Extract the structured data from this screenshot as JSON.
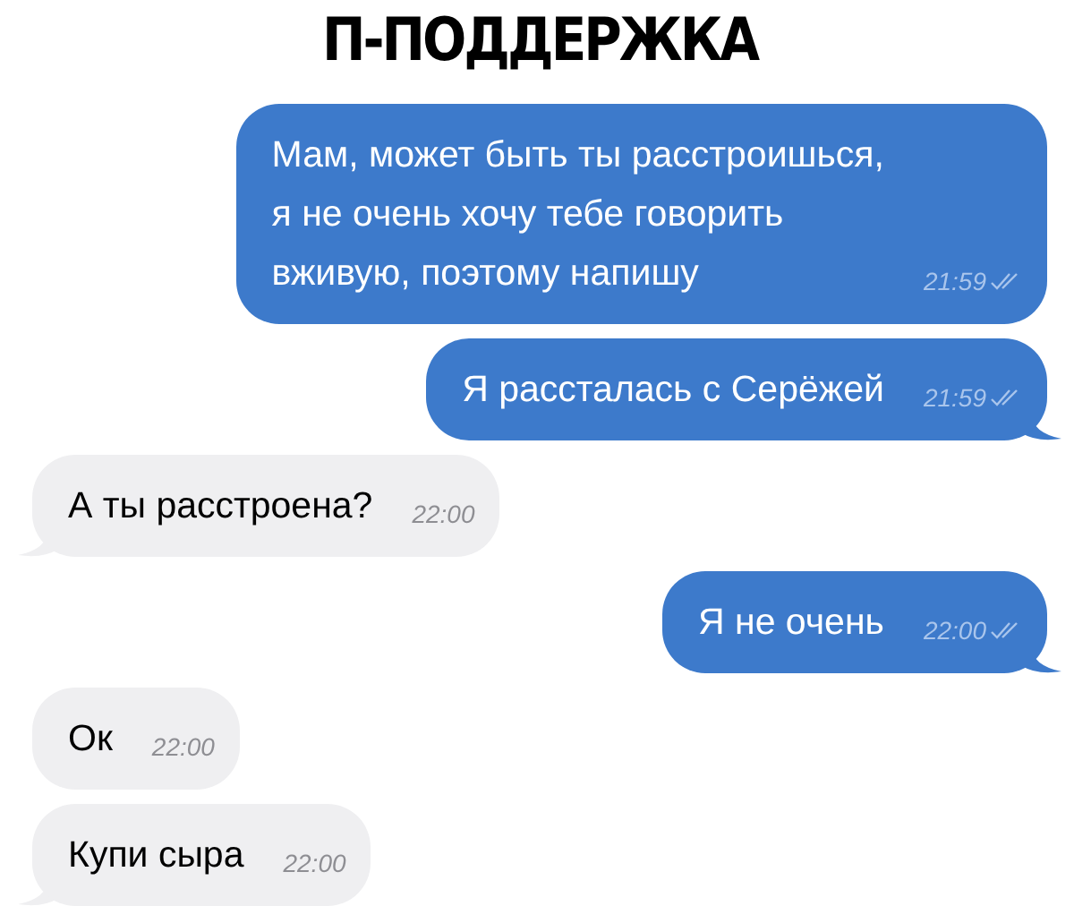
{
  "title": "П-ПОДДЕРЖКА",
  "messages": [
    {
      "kind": "outgoing",
      "text": "Мам, может быть ты расстроишься,\nя не очень хочу тебе говорить\nвживую, поэтому напишу",
      "time": "21:59",
      "read": true,
      "tail": false
    },
    {
      "kind": "outgoing",
      "text": "Я рассталась с Серёжей",
      "time": "21:59",
      "read": true,
      "tail": true
    },
    {
      "kind": "incoming",
      "text": "А ты расстроена?",
      "time": "22:00",
      "tail": true
    },
    {
      "kind": "outgoing",
      "text": "Я не очень",
      "time": "22:00",
      "read": true,
      "tail": true
    },
    {
      "kind": "incoming",
      "text": "Ок",
      "time": "22:00",
      "tail": false
    },
    {
      "kind": "incoming",
      "text": "Купи сыра",
      "time": "22:00",
      "tail": true
    }
  ]
}
